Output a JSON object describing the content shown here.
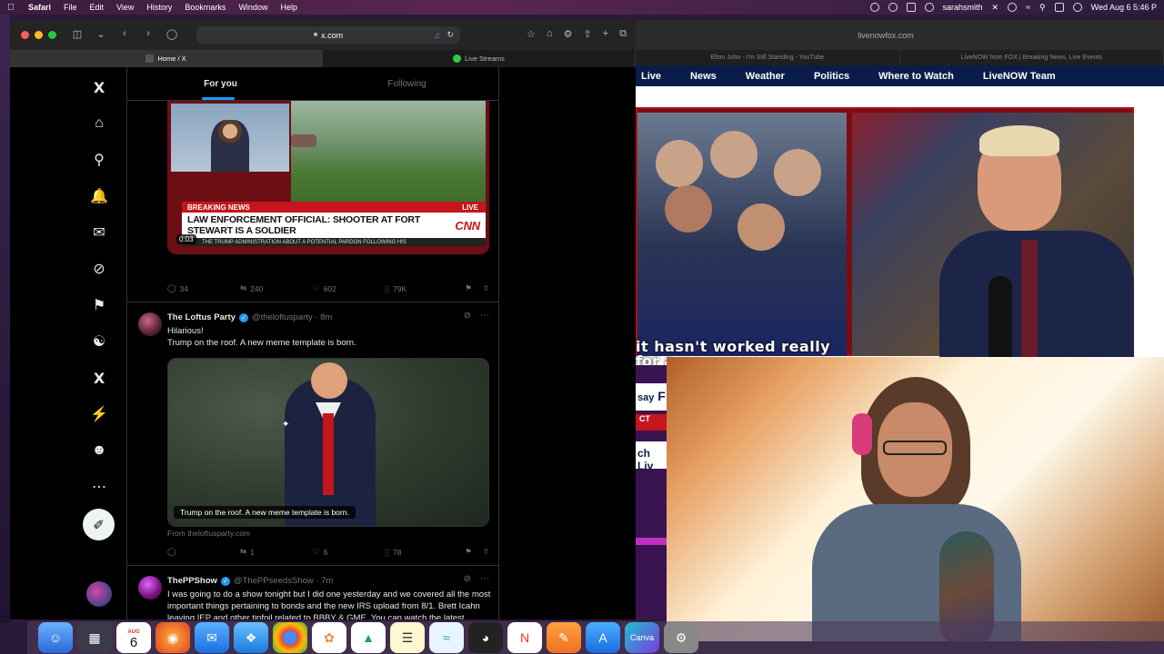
{
  "menubar": {
    "app": "Safari",
    "items": [
      "File",
      "Edit",
      "View",
      "History",
      "Bookmarks",
      "Window",
      "Help"
    ],
    "user": "sarahsmith",
    "clock": "Wed Aug 6  5:46 P"
  },
  "left_window": {
    "url": "x.com",
    "tabs": [
      {
        "label": "Home / X"
      },
      {
        "label": "Live Streams"
      }
    ]
  },
  "x": {
    "feed_tabs": [
      "For you",
      "Following"
    ],
    "video_post": {
      "breaking": "BREAKING NEWS",
      "live": "LIVE",
      "headline": "LAW ENFORCEMENT OFFICIAL: SHOOTER AT FORT STEWART IS A SOLDIER",
      "ticker": "THE TRUMP ADMINISTRATION ABOUT A POTENTIAL PARDON FOLLOWING HIS",
      "network": "CNN",
      "time": "0:03",
      "replies": "34",
      "reposts": "240",
      "likes": "602",
      "views": "79K"
    },
    "post2": {
      "name": "The Loftus Party",
      "handle": "@theloftusparty · 8m",
      "text1": "Hilarious!",
      "text2": "Trump on the roof. A new meme template is born.",
      "caption": "Trump on the roof. A new meme template is born.",
      "source": "From theloftusparty.com",
      "replies": "",
      "reposts": "1",
      "likes": "6",
      "views": "78"
    },
    "post3": {
      "name": "ThePPShow",
      "handle": "@ThePPseedsShow · 7m",
      "text": "I was going to do a show tonight but I did one yesterday and we covered all the most important things pertaining to bonds and the new IRS upload from 8/1. Brett Icahn leaving IEP and other tinfoil related to BBBY & GME. You can watch the latest episode pinned to my profile on X"
    }
  },
  "right_window": {
    "url": "livenowfox.com",
    "tabs": [
      "Elton John - I'm Still Standing - YouTube",
      "LiveNOW from FOX | Breaking News, Live Events"
    ],
    "nav": [
      "Live",
      "News",
      "Weather",
      "Politics",
      "Where to Watch",
      "LiveNOW Team"
    ],
    "caption_line1": "it  hasn't  worked  really",
    "caption_line2": "for a",
    "lower_strip": "CT",
    "lower_strip2": "F",
    "say": "say",
    "live_text": "ch Liv"
  },
  "dock": {
    "calendar_month": "AUG",
    "calendar_day": "6",
    "canva": "Canva"
  },
  "colors": {
    "x_blue": "#1d9bf0",
    "cnn_red": "#c4161c",
    "fox_navy": "#0a1d4a"
  }
}
